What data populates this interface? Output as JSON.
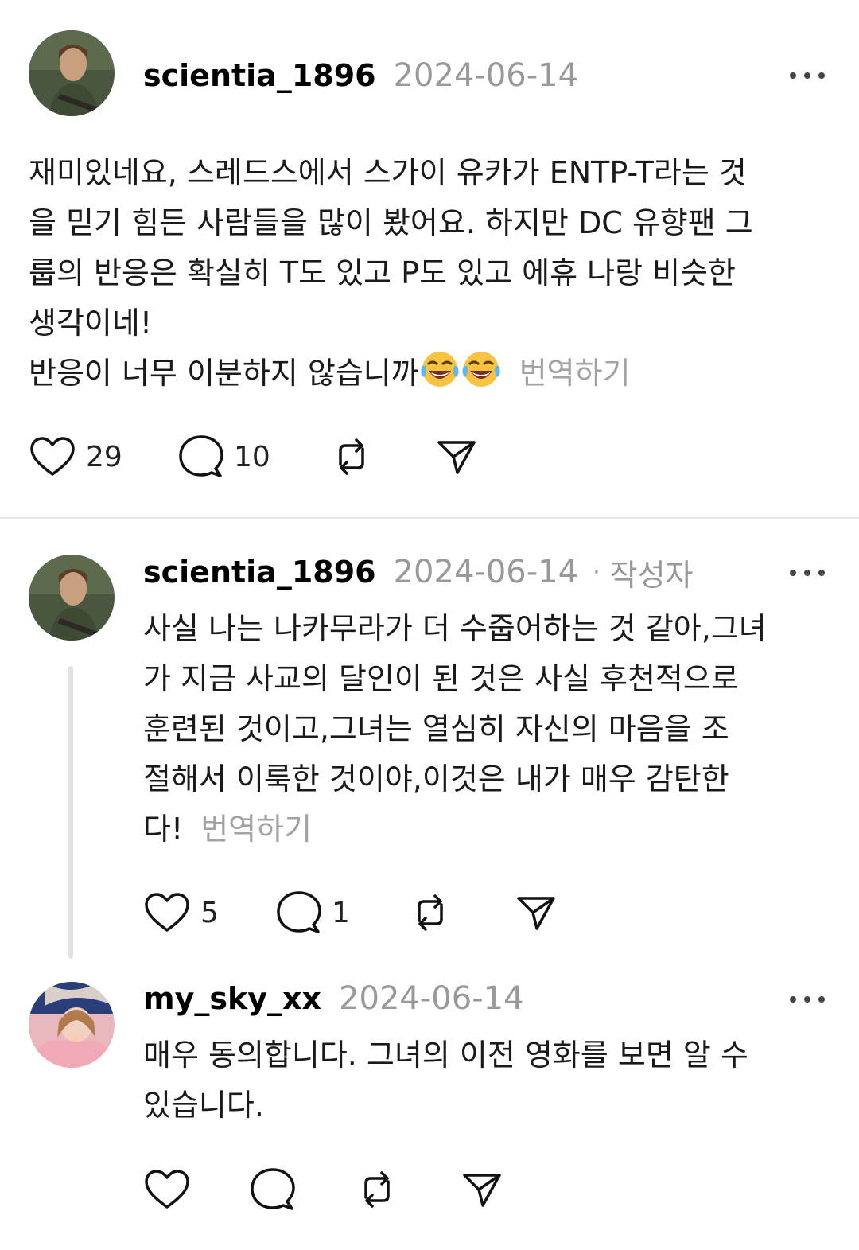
{
  "posts": [
    {
      "username": "scientia_1896",
      "date": "2024-06-14",
      "lines": [
        "재미있네요, 스레드스에서 스가이 유카가 ENTP-T라는 것",
        "을 믿기 힘든 사람들을 많이 봤어요. 하지만 DC 유향팬 그",
        "룹의 반응은 확실히 T도 있고 P도 있고 에휴 나랑 비슷한",
        "생각이네!",
        "반응이 너무 이분하지 않습니까"
      ],
      "translate_label": "번역하기",
      "likes": "29",
      "comments": "10"
    },
    {
      "username": "scientia_1896",
      "date": "2024-06-14",
      "separator": "·",
      "author_tag": "작성자",
      "lines": [
        "사실 나는 나카무라가 더 수줍어하는 것 같아,그녀",
        "가 지금 사교의 달인이 된 것은 사실 후천적으로",
        "훈련된 것이고,그녀는 열심히 자신의 마음을 조",
        "절해서 이룩한 것이야,이것은 내가 매우 감탄한",
        "다!"
      ],
      "translate_label": "번역하기",
      "likes": "5",
      "comments": "1"
    },
    {
      "username": "my_sky_xx",
      "date": "2024-06-14",
      "lines": [
        "매우 동의합니다. 그녀의 이전 영화를 보면 알 수",
        "있습니다."
      ]
    }
  ],
  "icons": {
    "like": "heart-icon",
    "comment": "comment-bubble-icon",
    "repost": "repost-icon",
    "share": "send-icon",
    "more": "more-horizontal-icon",
    "emoji": "tears-of-joy-emoji"
  },
  "colors": {
    "text": "#1a1a1a",
    "secondary": "#999999",
    "divider": "#e6e6e6"
  }
}
